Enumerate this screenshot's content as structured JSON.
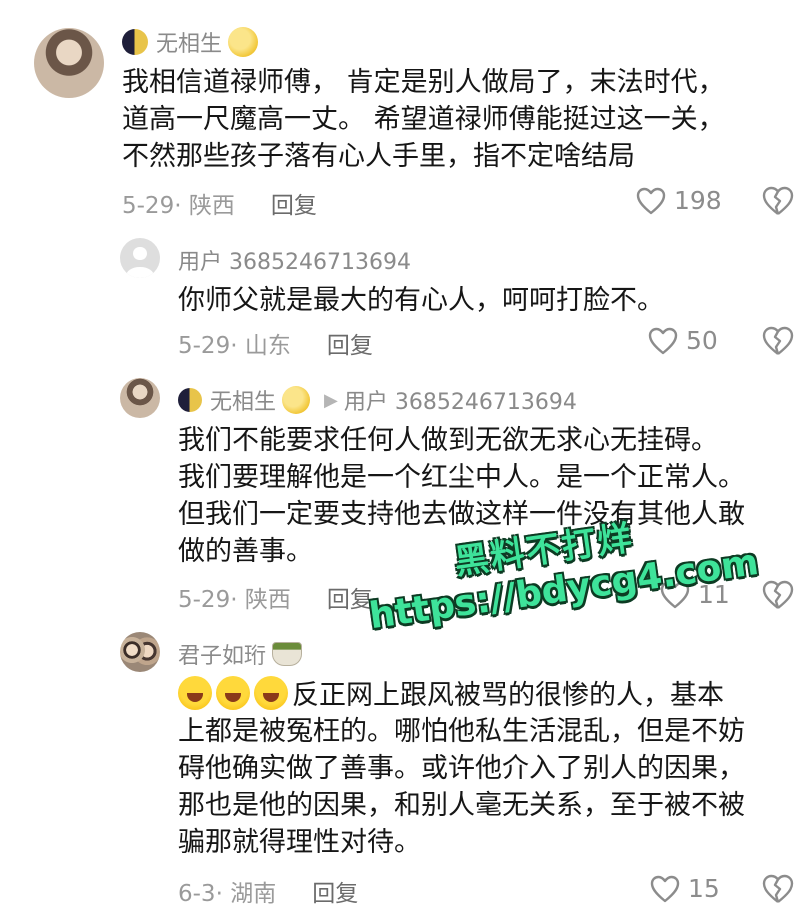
{
  "comments": [
    {
      "username": "无相生",
      "lines": [
        "我相信道禄师傅， 肯定是别人做局了，末法时代，",
        "道高一尺魔高一丈。 希望道禄师傅能挺过这一关，",
        "不然那些孩子落有心人手里，指不定啥结局"
      ],
      "date_location": "5-29· 陕西",
      "reply_label": "回复",
      "likes": "198"
    },
    {
      "username": "用户 3685246713694",
      "lines": [
        "你师父就是最大的有心人，呵呵打脸不。"
      ],
      "date_location": "5-29· 山东",
      "reply_label": "回复",
      "likes": "50"
    },
    {
      "username": "无相生",
      "reply_to": "用户 3685246713694",
      "lines": [
        "我们不能要求任何人做到无欲无求心无挂碍。",
        "我们要理解他是一个红尘中人。是一个正常人。",
        "但我们一定要支持他去做这样一件没有其他人敢",
        "做的善事。"
      ],
      "date_location": "5-29· 陕西",
      "reply_label": "回复",
      "likes": "11"
    },
    {
      "username": "君子如珩",
      "first_line": "反正网上跟风被骂的很惨的人，基本",
      "lines": [
        "上都是被冤枉的。哪怕他私生活混乱，但是不妨",
        "碍他确实做了善事。或许他介入了别人的因果，",
        "那也是他的因果，和别人毫无关系，至于被不被",
        "骗那就得理性对待。"
      ],
      "date_location": "6-3· 湖南",
      "reply_label": "回复",
      "likes": "15"
    }
  ],
  "watermark": {
    "line1": "黑料不打烊",
    "line2": "https://bdycg4.com"
  },
  "icons": {
    "heart": "heart-outline-icon",
    "dislike": "broken-heart-icon",
    "reply_arrow": "play-arrow-icon"
  },
  "colors": {
    "text": "#161616",
    "meta": "#9a9a9a",
    "watermark": "#3ee39a"
  }
}
